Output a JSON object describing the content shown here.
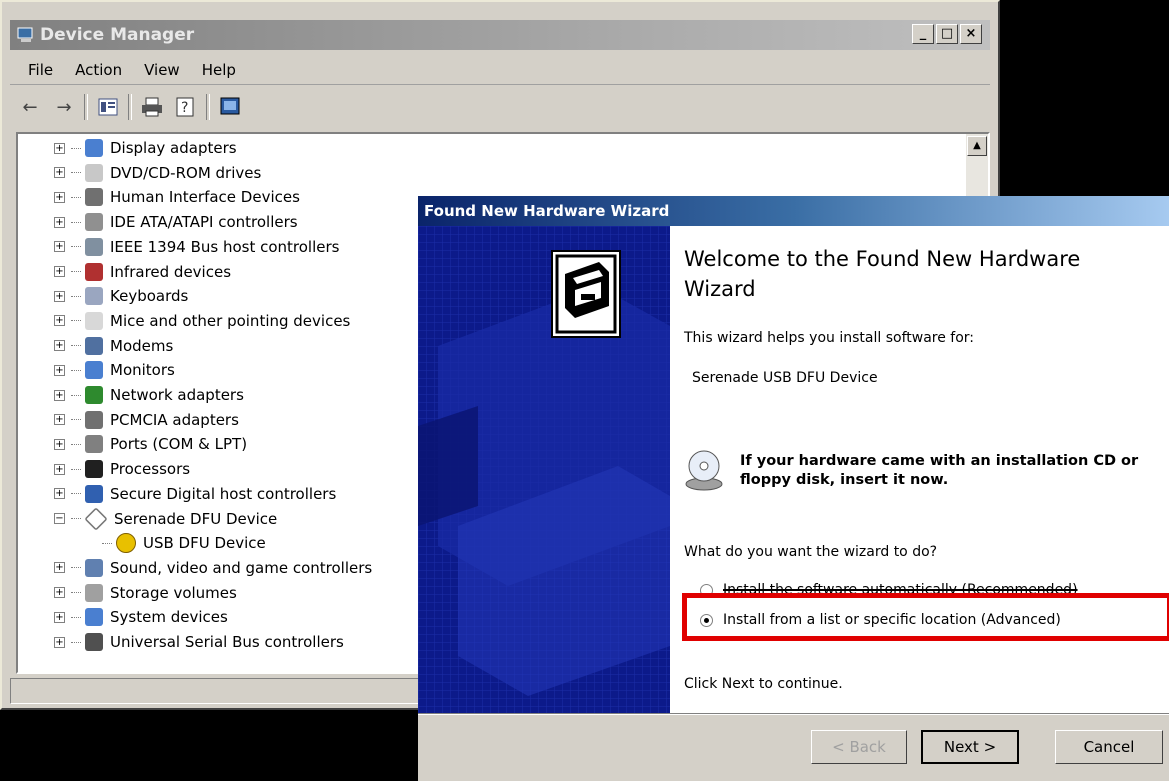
{
  "device_manager": {
    "title": "Device Manager",
    "menu": [
      "File",
      "Action",
      "View",
      "Help"
    ],
    "caption_buttons": [
      "_",
      "□",
      "×"
    ],
    "toolbar_icons": [
      "back-arrow-icon",
      "forward-arrow-icon",
      "properties-icon",
      "print-icon",
      "help-icon",
      "scan-hardware-icon"
    ],
    "tree": [
      {
        "label": "Display adapters",
        "icon": "display-adapter-icon",
        "expander": "+",
        "color": "#4a7fd0"
      },
      {
        "label": "DVD/CD-ROM drives",
        "icon": "dvd-drive-icon",
        "expander": "+",
        "color": "#c8c8c8"
      },
      {
        "label": "Human Interface Devices",
        "icon": "hid-icon",
        "expander": "+",
        "color": "#707070"
      },
      {
        "label": "IDE ATA/ATAPI controllers",
        "icon": "ide-controller-icon",
        "expander": "+",
        "color": "#909090"
      },
      {
        "label": "IEEE 1394 Bus host controllers",
        "icon": "ieee1394-icon",
        "expander": "+",
        "color": "#8090a0"
      },
      {
        "label": "Infrared devices",
        "icon": "infrared-icon",
        "expander": "+",
        "color": "#b03030"
      },
      {
        "label": "Keyboards",
        "icon": "keyboard-icon",
        "expander": "+",
        "color": "#9aa6c0"
      },
      {
        "label": "Mice and other pointing devices",
        "icon": "mouse-icon",
        "expander": "+",
        "color": "#d8d8d8"
      },
      {
        "label": "Modems",
        "icon": "modem-icon",
        "expander": "+",
        "color": "#5070a0"
      },
      {
        "label": "Monitors",
        "icon": "monitor-icon",
        "expander": "+",
        "color": "#4a7fd0"
      },
      {
        "label": "Network adapters",
        "icon": "network-adapter-icon",
        "expander": "+",
        "color": "#2e8a2e"
      },
      {
        "label": "PCMCIA adapters",
        "icon": "pcmcia-icon",
        "expander": "+",
        "color": "#707070"
      },
      {
        "label": "Ports (COM & LPT)",
        "icon": "port-icon",
        "expander": "+",
        "color": "#808080"
      },
      {
        "label": "Processors",
        "icon": "processor-icon",
        "expander": "+",
        "color": "#202020"
      },
      {
        "label": "Secure Digital host controllers",
        "icon": "sd-controller-icon",
        "expander": "+",
        "color": "#3060b0"
      },
      {
        "label": "Serenade DFU Device",
        "icon": "unknown-device-icon",
        "expander": "−",
        "color": "#909090"
      },
      {
        "label": "USB DFU Device",
        "icon": "warning-device-icon",
        "expander": "",
        "color": "#e8c000"
      },
      {
        "label": "Sound, video and game controllers",
        "icon": "sound-icon",
        "expander": "+",
        "color": "#6080b0"
      },
      {
        "label": "Storage volumes",
        "icon": "storage-volume-icon",
        "expander": "+",
        "color": "#a0a0a0"
      },
      {
        "label": "System devices",
        "icon": "system-device-icon",
        "expander": "+",
        "color": "#4a7fd0"
      },
      {
        "label": "Universal Serial Bus controllers",
        "icon": "usb-icon",
        "expander": "+",
        "color": "#505050"
      }
    ]
  },
  "wizard": {
    "title": "Found New Hardware Wizard",
    "heading": "Welcome to the Found New Hardware Wizard",
    "intro": "This wizard helps you install software for:",
    "device": "Serenade USB DFU Device",
    "cd_prompt": "If your hardware came with an installation CD or floppy disk, insert it now.",
    "question": "What do you want the wizard to do?",
    "options": [
      {
        "label": "Install the software automatically (Recommended)",
        "selected": false
      },
      {
        "label": "Install from a list or specific location (Advanced)",
        "selected": true
      }
    ],
    "continue_text": "Click Next to continue.",
    "buttons": {
      "back": "< Back",
      "next": "Next >",
      "cancel": "Cancel"
    }
  },
  "colors": {
    "highlight": "#e00000",
    "wizard_title": "#0a246a",
    "wizard_banner": "#0c1a8a"
  }
}
